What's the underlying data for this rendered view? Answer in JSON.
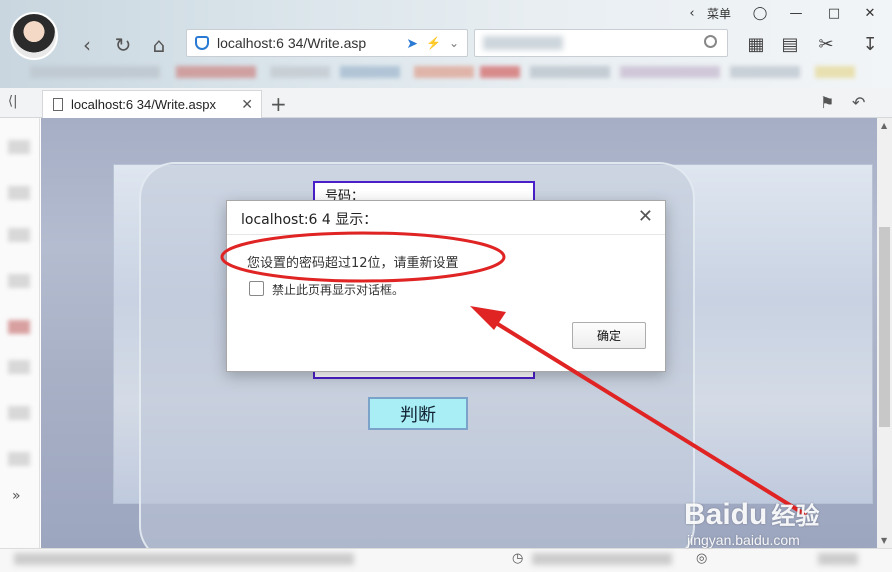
{
  "browser": {
    "window_menu_label": "菜单",
    "address_url": "localhost:6   34/Write.asp",
    "tab_title": "localhost:6   34/Write.aspx",
    "colors": {
      "accent": "#2a7ad3",
      "annotation": "#e02424"
    }
  },
  "page": {
    "form_label": "号码：",
    "judge_button": "判断"
  },
  "dialog": {
    "title": "localhost:6   4 显示：",
    "message": "您设置的密码超过12位，请重新设置",
    "checkbox_label": "禁止此页再显示对话框。",
    "ok_button": "确定"
  },
  "watermark": {
    "logo": "Baidu",
    "brand_cn": "经验",
    "url": "jingyan.baidu.com"
  }
}
